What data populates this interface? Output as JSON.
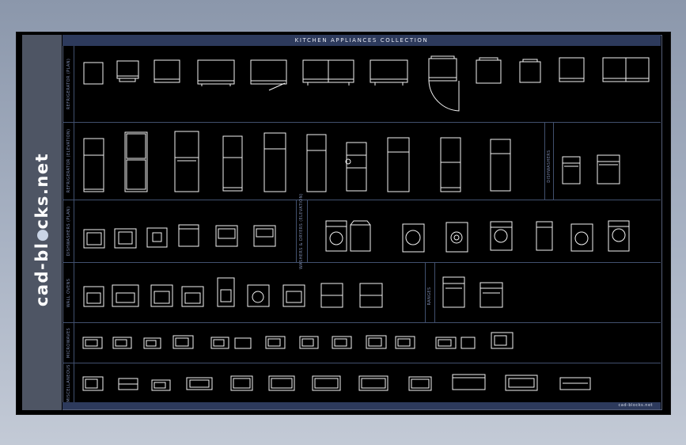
{
  "sheet": {
    "brand": {
      "prefix": "cad-bl",
      "suffix": "cks.net"
    },
    "title": "KITCHEN APPLIANCES COLLECTION",
    "footer": "cad-blocks.net",
    "sections": [
      {
        "label": "REFRIGERATOR (PLAN)"
      },
      {
        "label": "REFRIGERATOR (ELEVATION)"
      },
      {
        "label": "DISHWASHERS"
      },
      {
        "label": "DISHWASHERS (PLAN)"
      },
      {
        "label": "WASHERS & DRYERS (ELEVATION)"
      },
      {
        "label": "WALL OVENS"
      },
      {
        "label": "RANGES"
      },
      {
        "label": "MICROWAVES"
      },
      {
        "label": "MISCELLANEOUS"
      }
    ]
  }
}
